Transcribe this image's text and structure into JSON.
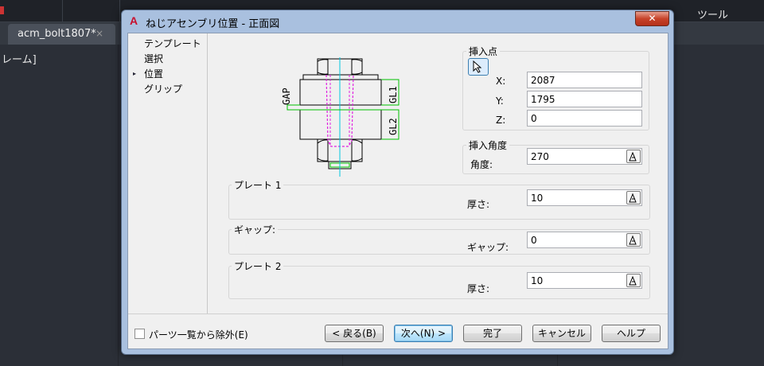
{
  "background": {
    "tab_label": "acm_bolt1807*",
    "tab_close": "×",
    "left_text": "レーム]",
    "menu_tool": "ツール"
  },
  "dialog": {
    "title": "ねじアセンブリ位置 - 正面図",
    "close": "✕",
    "nav": {
      "items": [
        "テンプレート",
        "選択",
        "位置",
        "グリップ"
      ],
      "active_bullet": "▸"
    },
    "diagram": {
      "gap_label": "GAP",
      "gl1_label": "GL1",
      "gl2_label": "GL2"
    },
    "insert_point": {
      "title": "挿入点",
      "x_label": "X:",
      "x_value": "2087",
      "y_label": "Y:",
      "y_value": "1795",
      "z_label": "Z:",
      "z_value": "0"
    },
    "insert_angle": {
      "title": "挿入角度",
      "angle_label": "角度:",
      "angle_value": "270"
    },
    "plate1": {
      "title": "プレート 1",
      "thickness_label": "厚さ:",
      "thickness_value": "10"
    },
    "gap": {
      "title": "ギャップ:",
      "gap_label": "ギャップ:",
      "gap_value": "0"
    },
    "plate2": {
      "title": "プレート 2",
      "thickness_label": "厚さ:",
      "thickness_value": "10"
    },
    "exclude_checkbox_label": "パーツ一覧から除外(E)",
    "buttons": {
      "back": "< 戻る(B)",
      "next": "次へ(N) >",
      "finish": "完了",
      "cancel": "キャンセル",
      "help": "ヘルプ"
    }
  },
  "colors": {
    "dialog_frame": "#a9c0df",
    "client_bg": "#f0f0f0",
    "close_button": "#c7432a",
    "diagram_green": "#00c000",
    "diagram_magenta": "#e020e0",
    "diagram_cyan": "#00c8e0"
  }
}
